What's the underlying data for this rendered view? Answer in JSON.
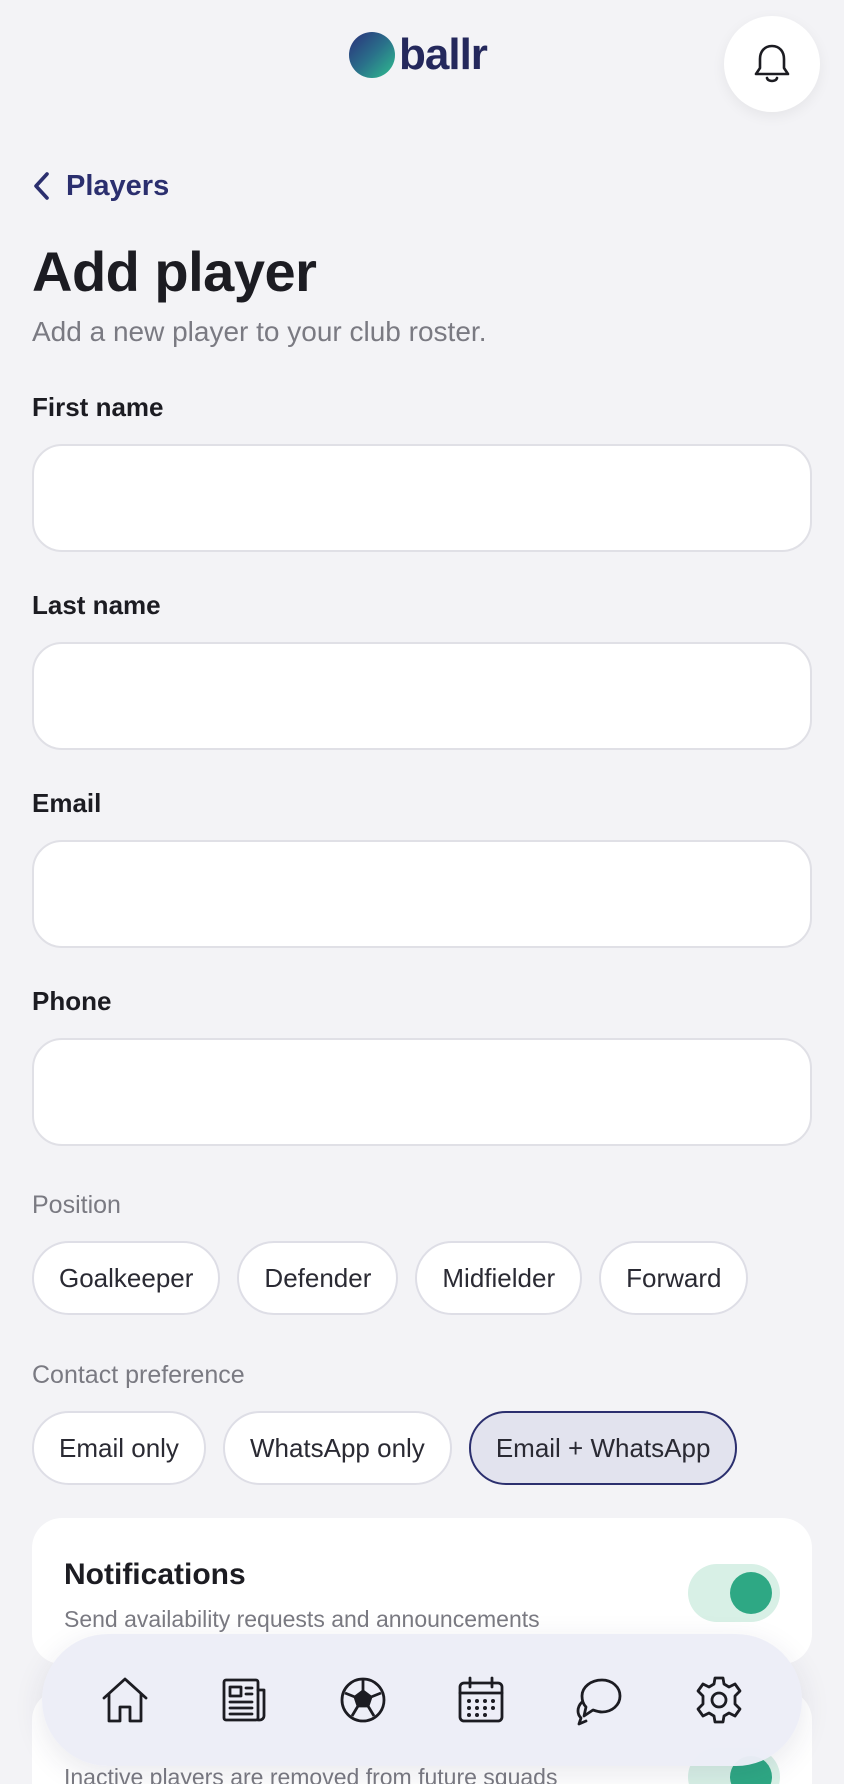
{
  "header": {
    "logo_text": "ballr",
    "notifications_icon": "bell-icon"
  },
  "nav_back": {
    "label": "Players",
    "icon": "chevron-left-icon"
  },
  "page": {
    "title": "Add player",
    "subtitle": "Add a new player to your club roster."
  },
  "form": {
    "first_name": {
      "label": "First name",
      "value": "",
      "placeholder": ""
    },
    "last_name": {
      "label": "Last name",
      "value": "",
      "placeholder": ""
    },
    "email": {
      "label": "Email",
      "value": "",
      "placeholder": ""
    },
    "phone": {
      "label": "Phone",
      "value": "",
      "placeholder": ""
    },
    "position": {
      "label": "Position",
      "options": [
        "Goalkeeper",
        "Defender",
        "Midfielder",
        "Forward"
      ],
      "selected": ""
    },
    "contact_preference": {
      "label": "Contact preference",
      "options": [
        "Email only",
        "WhatsApp only",
        "Email + WhatsApp"
      ],
      "selected": "Email + WhatsApp"
    }
  },
  "settings": {
    "notifications": {
      "title": "Notifications",
      "description": "Send availability requests and announcements",
      "enabled": true
    },
    "inactive": {
      "description": "Inactive players are removed from future squads",
      "enabled": true
    }
  },
  "bottom_nav": {
    "items": [
      {
        "icon": "home-icon"
      },
      {
        "icon": "news-icon"
      },
      {
        "icon": "football-icon"
      },
      {
        "icon": "calendar-icon"
      },
      {
        "icon": "chat-icon"
      },
      {
        "icon": "settings-gear-icon"
      }
    ]
  },
  "colors": {
    "background": "#f3f3f6",
    "brand_navy": "#2b2f6e",
    "accent_green": "#2ea884",
    "toggle_track": "#d8f0e6",
    "chip_selected_bg": "#e2e3ee"
  }
}
